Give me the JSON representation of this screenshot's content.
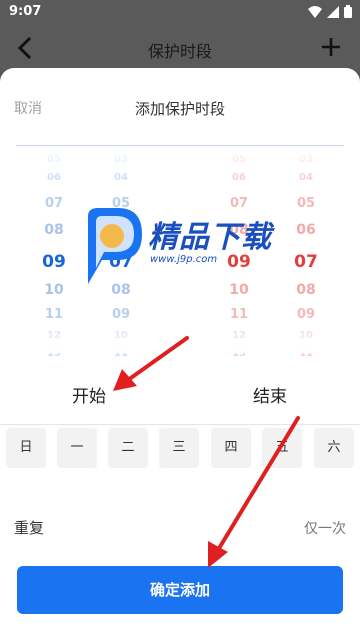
{
  "status_bar": {
    "time": "9:07"
  },
  "header": {
    "title": "保护时段"
  },
  "sheet": {
    "cancel_label": "取消",
    "title": "添加保护时段"
  },
  "start_hours": [
    "05",
    "06",
    "07",
    "08",
    "09",
    "10",
    "11",
    "12",
    "13"
  ],
  "start_minutes": [
    "03",
    "04",
    "05",
    "06",
    "07",
    "08",
    "09",
    "10",
    "11"
  ],
  "end_hours": [
    "05",
    "06",
    "07",
    "08",
    "09",
    "10",
    "11",
    "12",
    "13"
  ],
  "end_minutes": [
    "03",
    "04",
    "05",
    "06",
    "07",
    "08",
    "09",
    "10",
    "11"
  ],
  "selected": {
    "start_hour": "09",
    "start_minute": "07",
    "end_hour": "09",
    "end_minute": "07"
  },
  "labels": {
    "start": "开始",
    "end": "结束"
  },
  "days": [
    "日",
    "一",
    "二",
    "三",
    "四",
    "五",
    "六"
  ],
  "repeat": {
    "label": "重复",
    "value": "仅一次"
  },
  "confirm_label": "确定添加",
  "watermark": {
    "text": "精品下载",
    "url": "www.j9p.com"
  },
  "colors": {
    "accent_blue": "#1a73f0",
    "end_red": "#e33e3e",
    "arrow_red": "#e02020"
  }
}
